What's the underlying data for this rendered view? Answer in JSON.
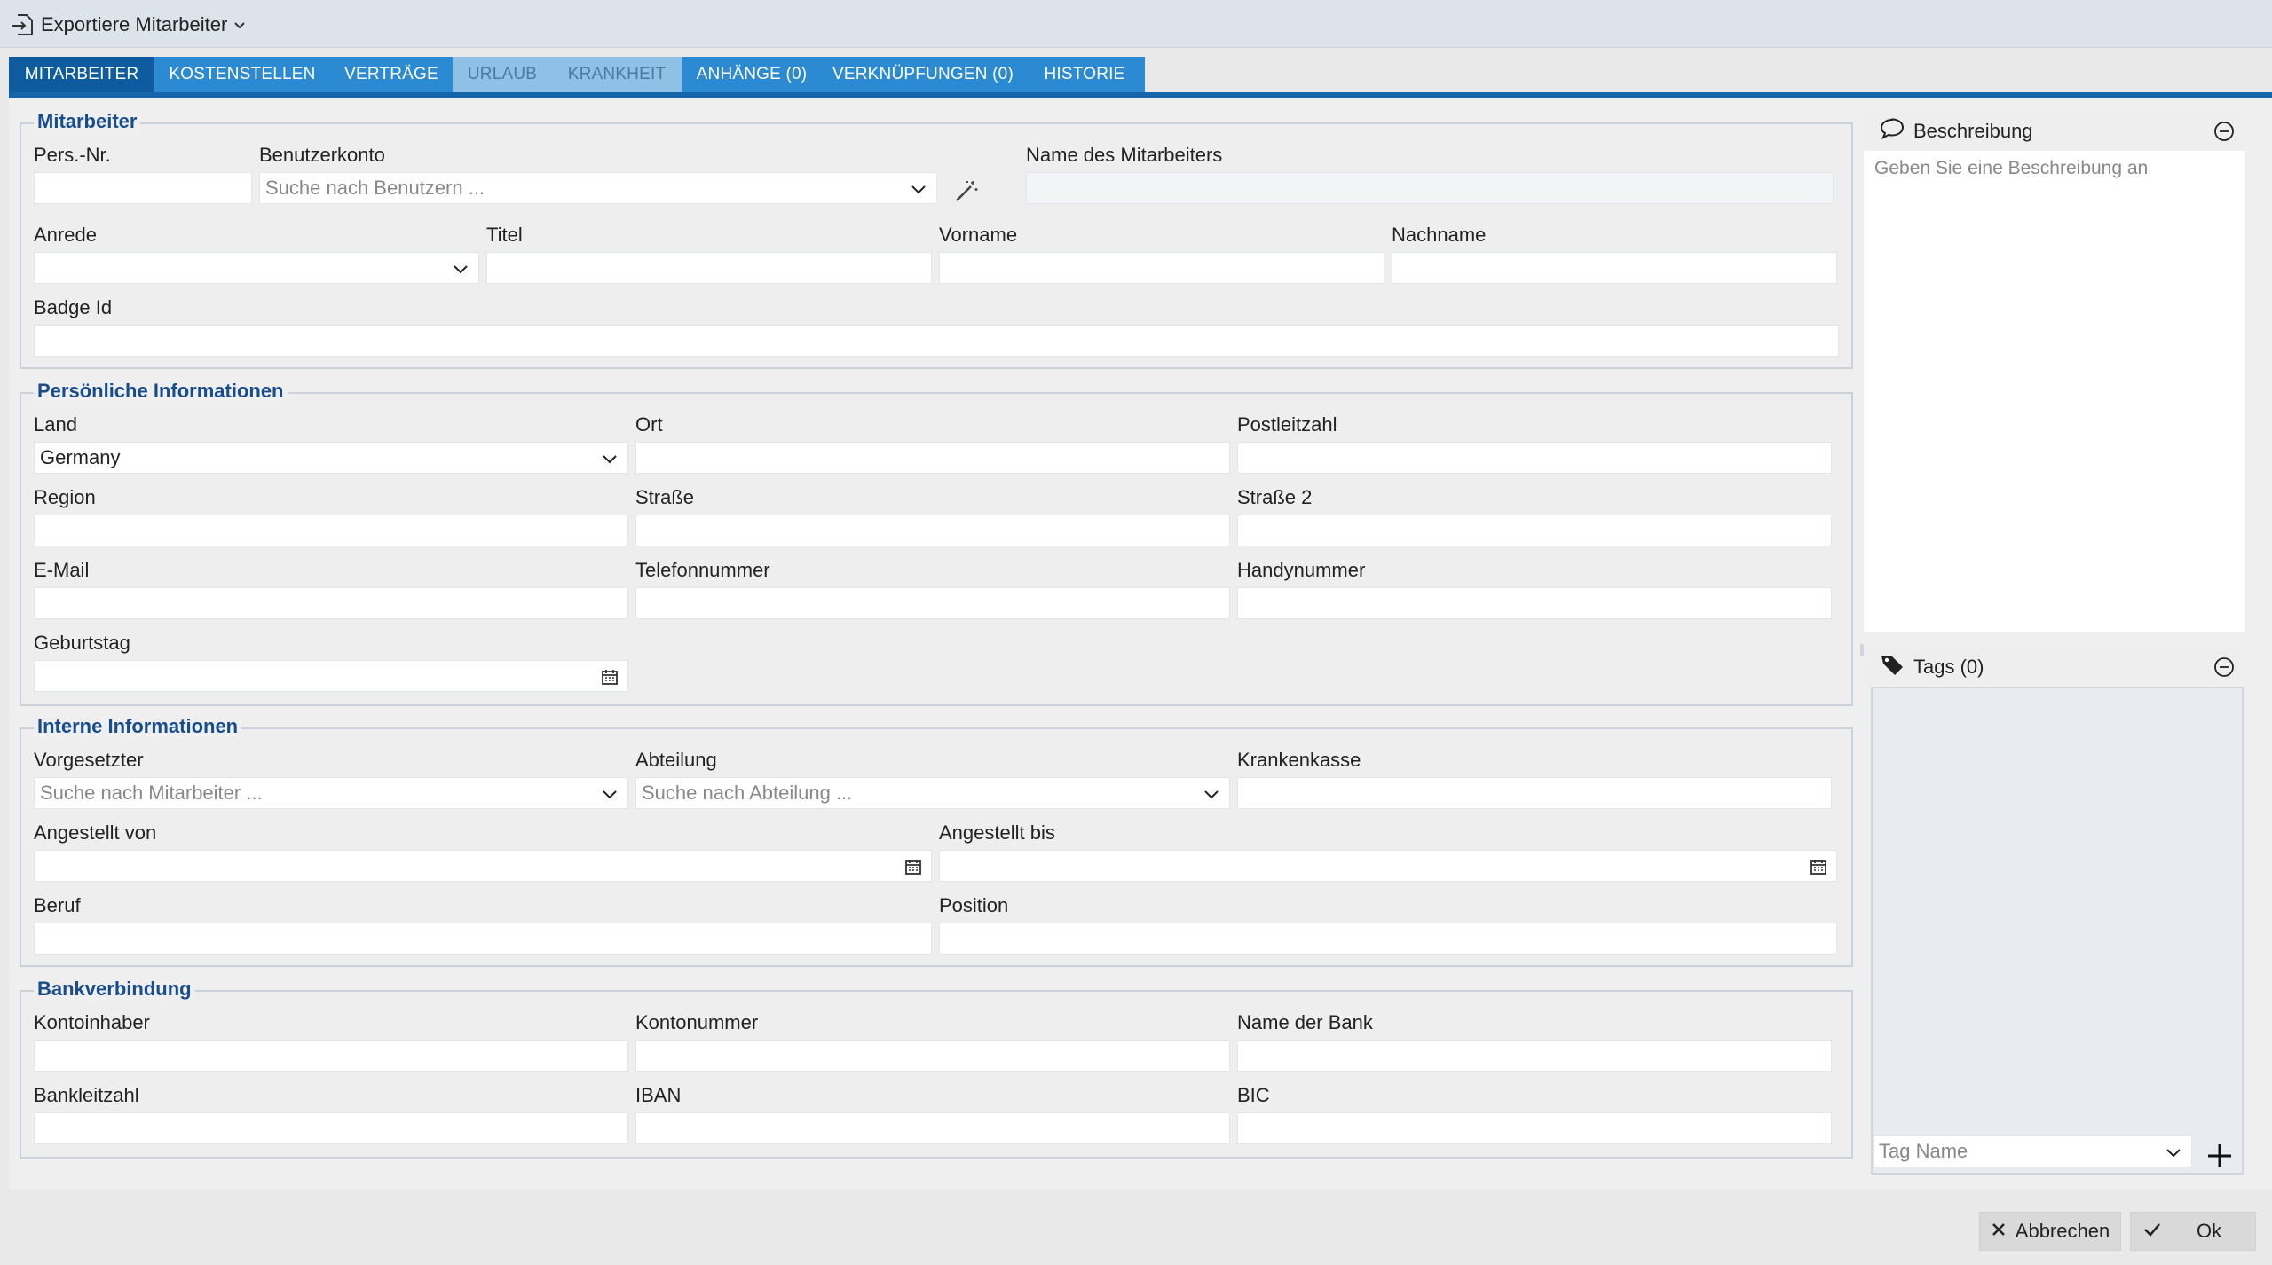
{
  "window": {
    "title": "Exportiere Mitarbeiter"
  },
  "tabs": [
    {
      "label": "MITARBEITER",
      "state": "active"
    },
    {
      "label": "KOSTENSTELLEN",
      "state": "normal"
    },
    {
      "label": "VERTRÄGE",
      "state": "normal"
    },
    {
      "label": "URLAUB",
      "state": "disabled"
    },
    {
      "label": "KRANKHEIT",
      "state": "disabled"
    },
    {
      "label": "ANHÄNGE (0)",
      "state": "normal"
    },
    {
      "label": "VERKNÜPFUNGEN (0)",
      "state": "normal"
    },
    {
      "label": "HISTORIE",
      "state": "normal"
    }
  ],
  "mitarbeiter": {
    "legend": "Mitarbeiter",
    "pers_nr": {
      "label": "Pers.-Nr.",
      "value": ""
    },
    "benutzerkonto": {
      "label": "Benutzerkonto",
      "placeholder": "Suche nach Benutzern ..."
    },
    "name_des_mitarbeiters": {
      "label": "Name des Mitarbeiters",
      "value": ""
    },
    "anrede": {
      "label": "Anrede",
      "value": ""
    },
    "titel": {
      "label": "Titel",
      "value": ""
    },
    "vorname": {
      "label": "Vorname",
      "value": ""
    },
    "nachname": {
      "label": "Nachname",
      "value": ""
    },
    "badge_id": {
      "label": "Badge Id",
      "value": ""
    }
  },
  "persoenlich": {
    "legend": "Persönliche Informationen",
    "land": {
      "label": "Land",
      "value": "Germany"
    },
    "ort": {
      "label": "Ort",
      "value": ""
    },
    "postleitzahl": {
      "label": "Postleitzahl",
      "value": ""
    },
    "region": {
      "label": "Region",
      "value": ""
    },
    "strasse": {
      "label": "Straße",
      "value": ""
    },
    "strasse2": {
      "label": "Straße 2",
      "value": ""
    },
    "email": {
      "label": "E-Mail",
      "value": ""
    },
    "telefon": {
      "label": "Telefonnummer",
      "value": ""
    },
    "handy": {
      "label": "Handynummer",
      "value": ""
    },
    "geburtstag": {
      "label": "Geburtstag",
      "value": ""
    }
  },
  "intern": {
    "legend": "Interne Informationen",
    "vorgesetzter": {
      "label": "Vorgesetzter",
      "placeholder": "Suche nach Mitarbeiter ..."
    },
    "abteilung": {
      "label": "Abteilung",
      "placeholder": "Suche nach Abteilung ..."
    },
    "krankenkasse": {
      "label": "Krankenkasse",
      "value": ""
    },
    "angestellt_von": {
      "label": "Angestellt von",
      "value": ""
    },
    "angestellt_bis": {
      "label": "Angestellt bis",
      "value": ""
    },
    "beruf": {
      "label": "Beruf",
      "value": ""
    },
    "position": {
      "label": "Position",
      "value": ""
    }
  },
  "bank": {
    "legend": "Bankverbindung",
    "kontoinhaber": {
      "label": "Kontoinhaber",
      "value": ""
    },
    "kontonummer": {
      "label": "Kontonummer",
      "value": ""
    },
    "name_der_bank": {
      "label": "Name der Bank",
      "value": ""
    },
    "bankleitzahl": {
      "label": "Bankleitzahl",
      "value": ""
    },
    "iban": {
      "label": "IBAN",
      "value": ""
    },
    "bic": {
      "label": "BIC",
      "value": ""
    }
  },
  "beschreibung": {
    "title": "Beschreibung",
    "placeholder": "Geben Sie eine Beschreibung an"
  },
  "tags": {
    "title": "Tags (0)",
    "input_placeholder": "Tag Name"
  },
  "footer": {
    "cancel_label": "Abbrechen",
    "ok_label": "Ok"
  },
  "colors": {
    "tab_active": "#0f5ba0",
    "tab": "#2c8ad2",
    "tab_disabled": "#8fc1e6",
    "legend": "#174d8c"
  }
}
